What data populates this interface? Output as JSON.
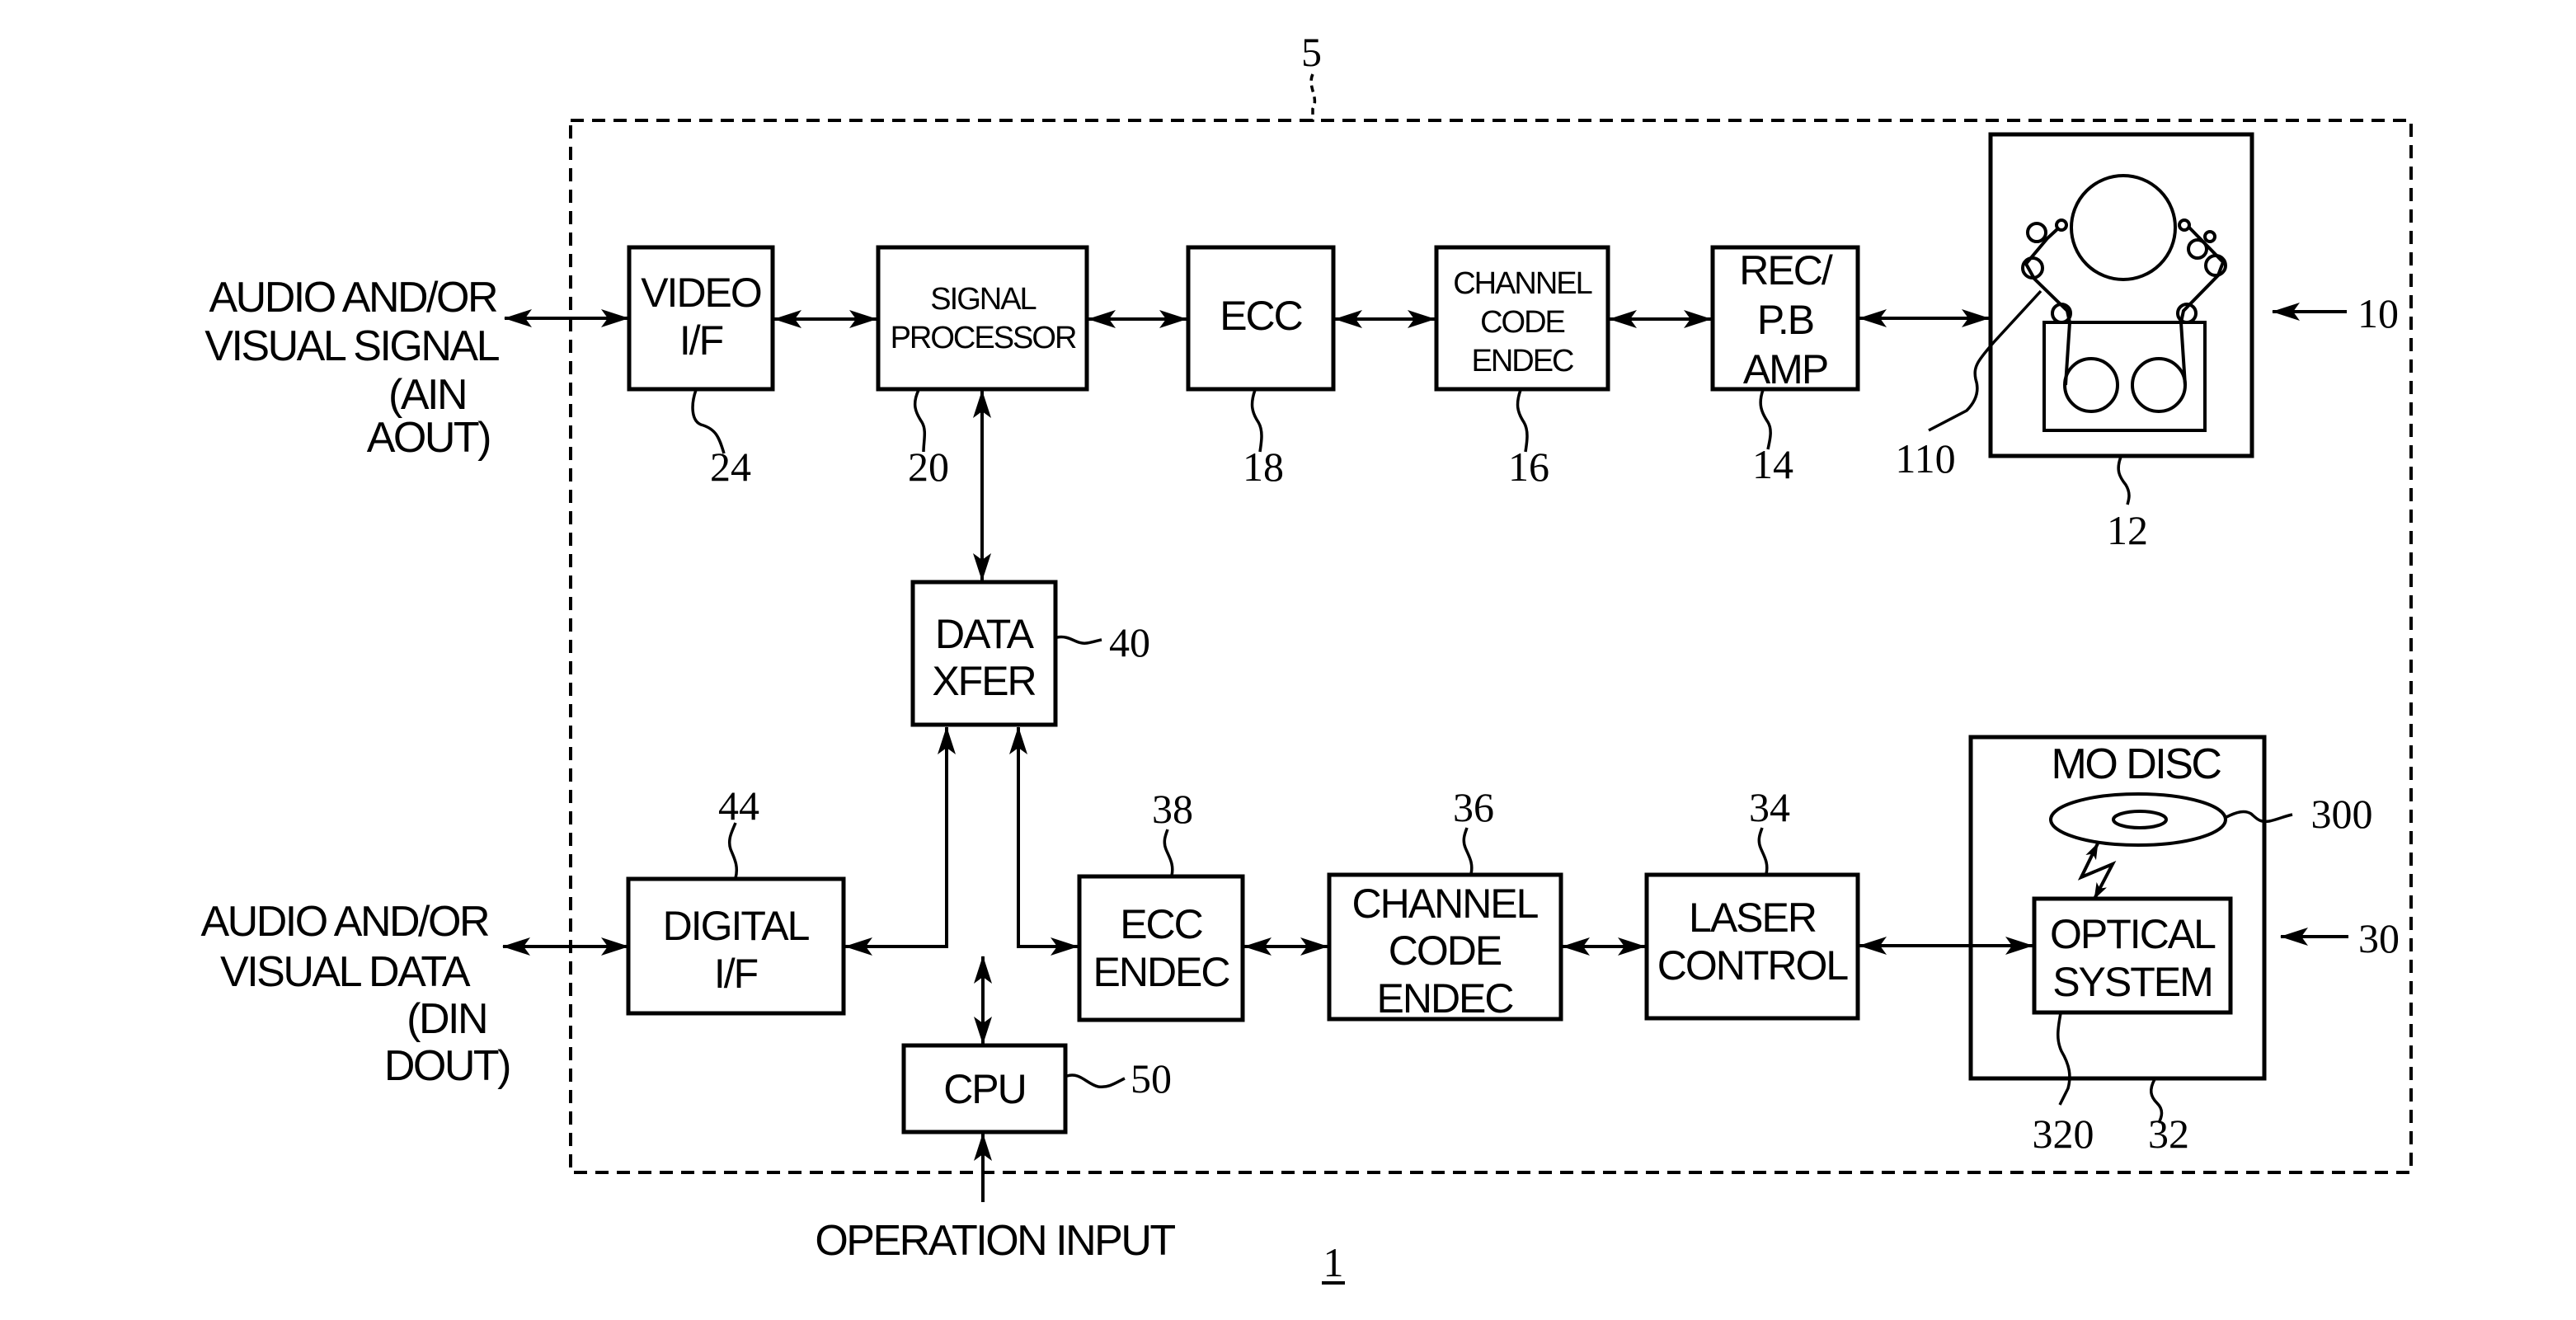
{
  "figure": {
    "figure_number": "1",
    "enclosure_ref": "5"
  },
  "external_labels": {
    "analog_io": [
      "AUDIO AND/OR",
      "VISUAL SIGNAL",
      "(AIN",
      "AOUT)"
    ],
    "digital_io": [
      "AUDIO AND/OR",
      "VISUAL DATA",
      "(DIN",
      "DOUT)"
    ],
    "operation_input": "OPERATION INPUT"
  },
  "blocks": {
    "video_if": {
      "lines": [
        "VIDEO",
        "I/F"
      ],
      "ref": "24"
    },
    "signal_processor": {
      "lines": [
        "SIGNAL",
        "PROCESSOR"
      ],
      "ref": "20"
    },
    "ecc": {
      "lines": [
        "ECC"
      ],
      "ref": "18"
    },
    "channel_code_endec_top": {
      "lines": [
        "CHANNEL",
        "CODE",
        "ENDEC"
      ],
      "ref": "16"
    },
    "rec_pb_amp": {
      "lines": [
        "REC/",
        "P.B",
        "AMP"
      ],
      "ref": "14"
    },
    "tape_mechanism": {
      "ref": "12",
      "head_ref": "110",
      "unit_ref": "10"
    },
    "data_xfer": {
      "lines": [
        "DATA",
        "XFER"
      ],
      "ref": "40"
    },
    "digital_if": {
      "lines": [
        "DIGITAL",
        "I/F"
      ],
      "ref": "44"
    },
    "cpu": {
      "lines": [
        "CPU"
      ],
      "ref": "50"
    },
    "ecc_endec": {
      "lines": [
        "ECC",
        "ENDEC"
      ],
      "ref": "38"
    },
    "channel_code_endec_bottom": {
      "lines": [
        "CHANNEL",
        "CODE",
        "ENDEC"
      ],
      "ref": "36"
    },
    "laser_control": {
      "lines": [
        "LASER",
        "CONTROL"
      ],
      "ref": "34"
    },
    "mo_drive": {
      "title": "MO DISC",
      "ref": "32",
      "disc_ref": "300",
      "unit_ref": "30"
    },
    "optical_system": {
      "lines": [
        "OPTICAL",
        "SYSTEM"
      ],
      "ref": "320"
    }
  }
}
